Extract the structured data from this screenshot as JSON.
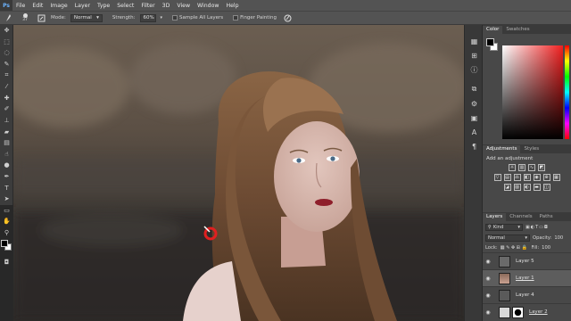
{
  "app": {
    "logo": "Ps"
  },
  "menu": [
    "File",
    "Edit",
    "Image",
    "Layer",
    "Type",
    "Select",
    "Filter",
    "3D",
    "View",
    "Window",
    "Help"
  ],
  "options": {
    "brush_size": "37",
    "mode_label": "Mode:",
    "mode_value": "Normal",
    "strength_label": "Strength:",
    "strength_value": "60%",
    "sample_all": "Sample All Layers",
    "finger_painting": "Finger Painting"
  },
  "tools": [
    "move-icon",
    "marquee-icon",
    "lasso-icon",
    "quick-select-icon",
    "crop-icon",
    "eyedropper-icon",
    "healing-icon",
    "brush-icon",
    "stamp-icon",
    "eraser-icon",
    "gradient-icon",
    "smudge-icon",
    "dodge-icon",
    "pen-icon",
    "type-icon",
    "path-select-icon",
    "shape-icon",
    "hand-icon",
    "zoom-icon"
  ],
  "color_panel": {
    "tabs": [
      "Color",
      "Swatches"
    ],
    "foreground": "#000000",
    "background": "#ffffff",
    "hue_color": "#f01f1f"
  },
  "adjustments_panel": {
    "tabs": [
      "Adjustments",
      "Styles"
    ],
    "title": "Add an adjustment"
  },
  "layers_panel": {
    "tabs": [
      "Layers",
      "Channels",
      "Paths"
    ],
    "kind": "Kind",
    "blend_mode": "Normal",
    "opacity_label": "Opacity:",
    "opacity_value": "100",
    "lock_label": "Lock:",
    "fill_label": "Fill:",
    "fill_value": "100",
    "layers": [
      {
        "name": "Layer 5",
        "selected": false
      },
      {
        "name": "Layer 1",
        "selected": true
      },
      {
        "name": "Layer 4",
        "selected": false
      },
      {
        "name": "Layer 2",
        "selected": false
      }
    ]
  }
}
